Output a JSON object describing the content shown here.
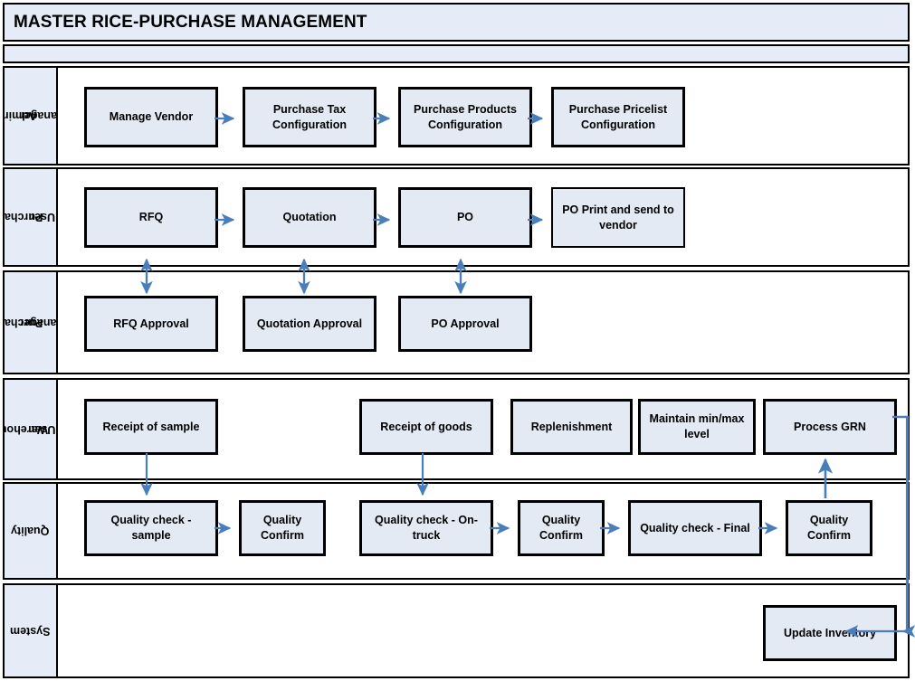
{
  "header": {
    "title": "MASTER RICE-PURCHASE MANAGEMENT",
    "subtitle": ""
  },
  "colors": {
    "lane_label_fill": "#e6ecf7",
    "box_fill": "#e4eaf4",
    "box_border": "#000000",
    "arrow": "#4a7ebb",
    "title_fill": "#e6ecf7"
  },
  "lanes": [
    {
      "id": "admin-manager",
      "label": "Admin/\nManager",
      "label_line1": "Admin/",
      "label_line2": "Manager",
      "boxes": [
        {
          "id": "manage-vendor",
          "label": "Manage Vendor"
        },
        {
          "id": "purchase-tax-configuration",
          "label": "Purchase Tax Configuration"
        },
        {
          "id": "purchase-products-configuration",
          "label": "Purchase Products Configuration"
        },
        {
          "id": "purchase-pricelist-configuration",
          "label": "Purchase Pricelist Configuration"
        }
      ]
    },
    {
      "id": "purchase-user",
      "label": "Purchase User",
      "label_line1": "Purchase",
      "label_line2": "User",
      "boxes": [
        {
          "id": "rfq",
          "label": "RFQ"
        },
        {
          "id": "quotation",
          "label": "Quotation"
        },
        {
          "id": "po",
          "label": "PO"
        },
        {
          "id": "po-print-send-vendor",
          "label": "PO Print and send to vendor"
        }
      ]
    },
    {
      "id": "purchase-manager",
      "label": "Purchase Manager",
      "label_line1": "Purchase",
      "label_line2": "Manager",
      "boxes": [
        {
          "id": "rfq-approval",
          "label": "RFQ Approval"
        },
        {
          "id": "quotation-approval",
          "label": "Quotation Approval"
        },
        {
          "id": "po-approval",
          "label": "PO Approval"
        }
      ]
    },
    {
      "id": "warehouse-user",
      "label": "Warehouse User",
      "label_line1": "Warehouse",
      "label_line2": "User",
      "boxes": [
        {
          "id": "receipt-of-sample",
          "label": "Receipt of sample"
        },
        {
          "id": "receipt-of-goods",
          "label": "Receipt of goods"
        },
        {
          "id": "replenishment",
          "label": "Replenishment"
        },
        {
          "id": "maintain-min-max-level",
          "label": "Maintain min/max level"
        },
        {
          "id": "process-grn",
          "label": "Process GRN"
        }
      ]
    },
    {
      "id": "quality",
      "label": "Quality",
      "label_line1": "Quality",
      "label_line2": "",
      "boxes": [
        {
          "id": "quality-check-sample",
          "label": "Quality check - sample"
        },
        {
          "id": "quality-confirm-1",
          "label": "Quality Confirm"
        },
        {
          "id": "quality-check-on-truck",
          "label": "Quality check - On-truck"
        },
        {
          "id": "quality-confirm-2",
          "label": "Quality Confirm"
        },
        {
          "id": "quality-check-final",
          "label": "Quality check - Final"
        },
        {
          "id": "quality-confirm-3",
          "label": "Quality Confirm"
        }
      ]
    },
    {
      "id": "system",
      "label": "System",
      "label_line1": "System",
      "label_line2": "",
      "boxes": [
        {
          "id": "update-inventory",
          "label": "Update Inventory"
        }
      ]
    }
  ],
  "connections": [
    {
      "from": "manage-vendor",
      "to": "purchase-tax-configuration",
      "kind": "arrow-right"
    },
    {
      "from": "purchase-tax-configuration",
      "to": "purchase-products-configuration",
      "kind": "arrow-right"
    },
    {
      "from": "purchase-products-configuration",
      "to": "purchase-pricelist-configuration",
      "kind": "arrow-right"
    },
    {
      "from": "rfq",
      "to": "quotation",
      "kind": "arrow-right"
    },
    {
      "from": "quotation",
      "to": "po",
      "kind": "arrow-right"
    },
    {
      "from": "po",
      "to": "po-print-send-vendor",
      "kind": "arrow-right"
    },
    {
      "from": "rfq",
      "to": "rfq-approval",
      "kind": "double-arrow-vertical"
    },
    {
      "from": "quotation",
      "to": "quotation-approval",
      "kind": "double-arrow-vertical"
    },
    {
      "from": "po",
      "to": "po-approval",
      "kind": "double-arrow-vertical"
    },
    {
      "from": "receipt-of-sample",
      "to": "quality-check-sample",
      "kind": "arrow-down"
    },
    {
      "from": "receipt-of-goods",
      "to": "quality-check-on-truck",
      "kind": "arrow-down"
    },
    {
      "from": "quality-check-sample",
      "to": "quality-confirm-1",
      "kind": "arrow-right"
    },
    {
      "from": "quality-check-on-truck",
      "to": "quality-confirm-2",
      "kind": "arrow-right"
    },
    {
      "from": "quality-confirm-2",
      "to": "quality-check-final",
      "kind": "arrow-right"
    },
    {
      "from": "quality-check-final",
      "to": "quality-confirm-3",
      "kind": "arrow-right"
    },
    {
      "from": "quality-confirm-3",
      "to": "process-grn",
      "kind": "arrow-up"
    },
    {
      "from": "process-grn",
      "to": "update-inventory",
      "kind": "elbow-right-down-left"
    }
  ]
}
